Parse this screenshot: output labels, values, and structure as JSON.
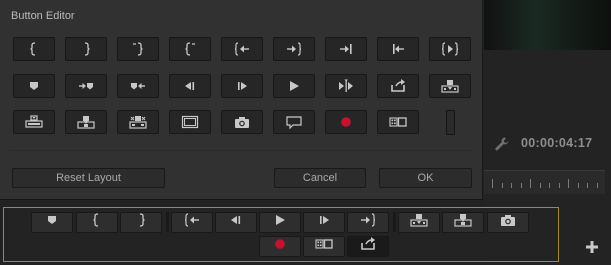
{
  "editor": {
    "title": "Button Editor",
    "buttons": [
      [
        "mark-in-icon",
        "mark-out-icon",
        "clear-in-icon",
        "clear-out-icon",
        "go-to-in-icon",
        "go-to-out-icon",
        "go-to-next-edit-icon",
        "go-to-previous-edit-icon",
        "play-in-to-out-icon"
      ],
      [
        "add-marker-icon",
        "go-to-next-marker-icon",
        "go-to-previous-marker-icon",
        "step-back-icon",
        "step-forward-icon",
        "play-stop-icon",
        "play-around-icon",
        "loop-icon",
        "insert-icon"
      ],
      [
        "lift-icon",
        "overwrite-icon",
        "extract-icon",
        "safe-margins-icon",
        "camera-icon",
        "comment-icon",
        "record-icon",
        "multi-camera-icon",
        "spacer"
      ]
    ],
    "reset_label": "Reset Layout",
    "cancel_label": "Cancel",
    "ok_label": "OK"
  },
  "monitor": {
    "timecode": "00:00:04:17"
  },
  "transport_bar": {
    "row1": [
      "add-marker-icon",
      "mark-in-icon",
      "mark-out-icon",
      "go-to-in-icon",
      "step-back-icon",
      "play-stop-icon",
      "step-forward-icon",
      "go-to-out-icon",
      "insert-icon",
      "overwrite-icon",
      "camera-icon"
    ],
    "row2": [
      "record-icon",
      "multi-camera-icon",
      "export-frame-icon"
    ]
  },
  "colors": {
    "accent_outline": "#a88822",
    "record": "#c8102e",
    "icon": "#c8c8c8"
  }
}
